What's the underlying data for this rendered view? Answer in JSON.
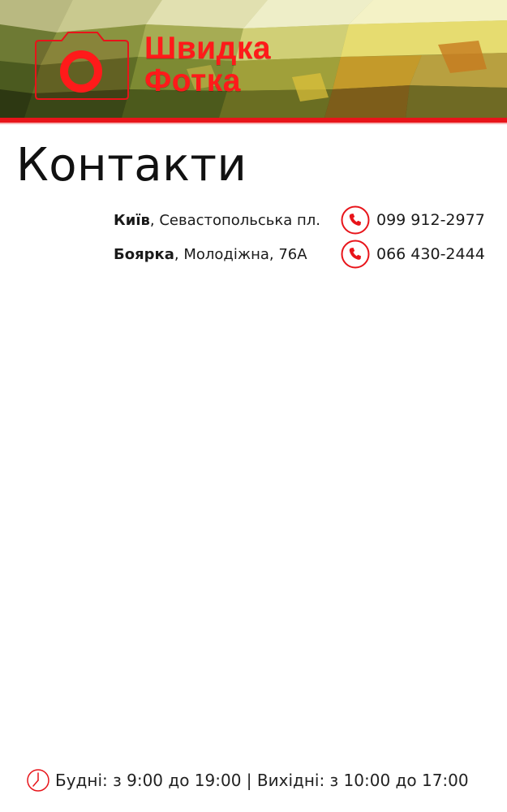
{
  "brand": {
    "line1": "Швидка",
    "line2": "Фотка",
    "accent_color": "#e8141a",
    "logo_icon": "camera-icon"
  },
  "page": {
    "title": "Контакти"
  },
  "contacts": [
    {
      "city": "Київ",
      "address": ", Севастопольська пл.",
      "phone": "099 912-2977",
      "icon": "phone-icon"
    },
    {
      "city": "Боярка",
      "address": ", Молодіжна, 76А",
      "phone": "066 430-2444",
      "icon": "phone-icon"
    }
  ],
  "footer": {
    "icon": "clock-icon",
    "hours": "Будні: з 9:00 до 19:00 | Вихідні: з 10:00 до 17:00"
  }
}
